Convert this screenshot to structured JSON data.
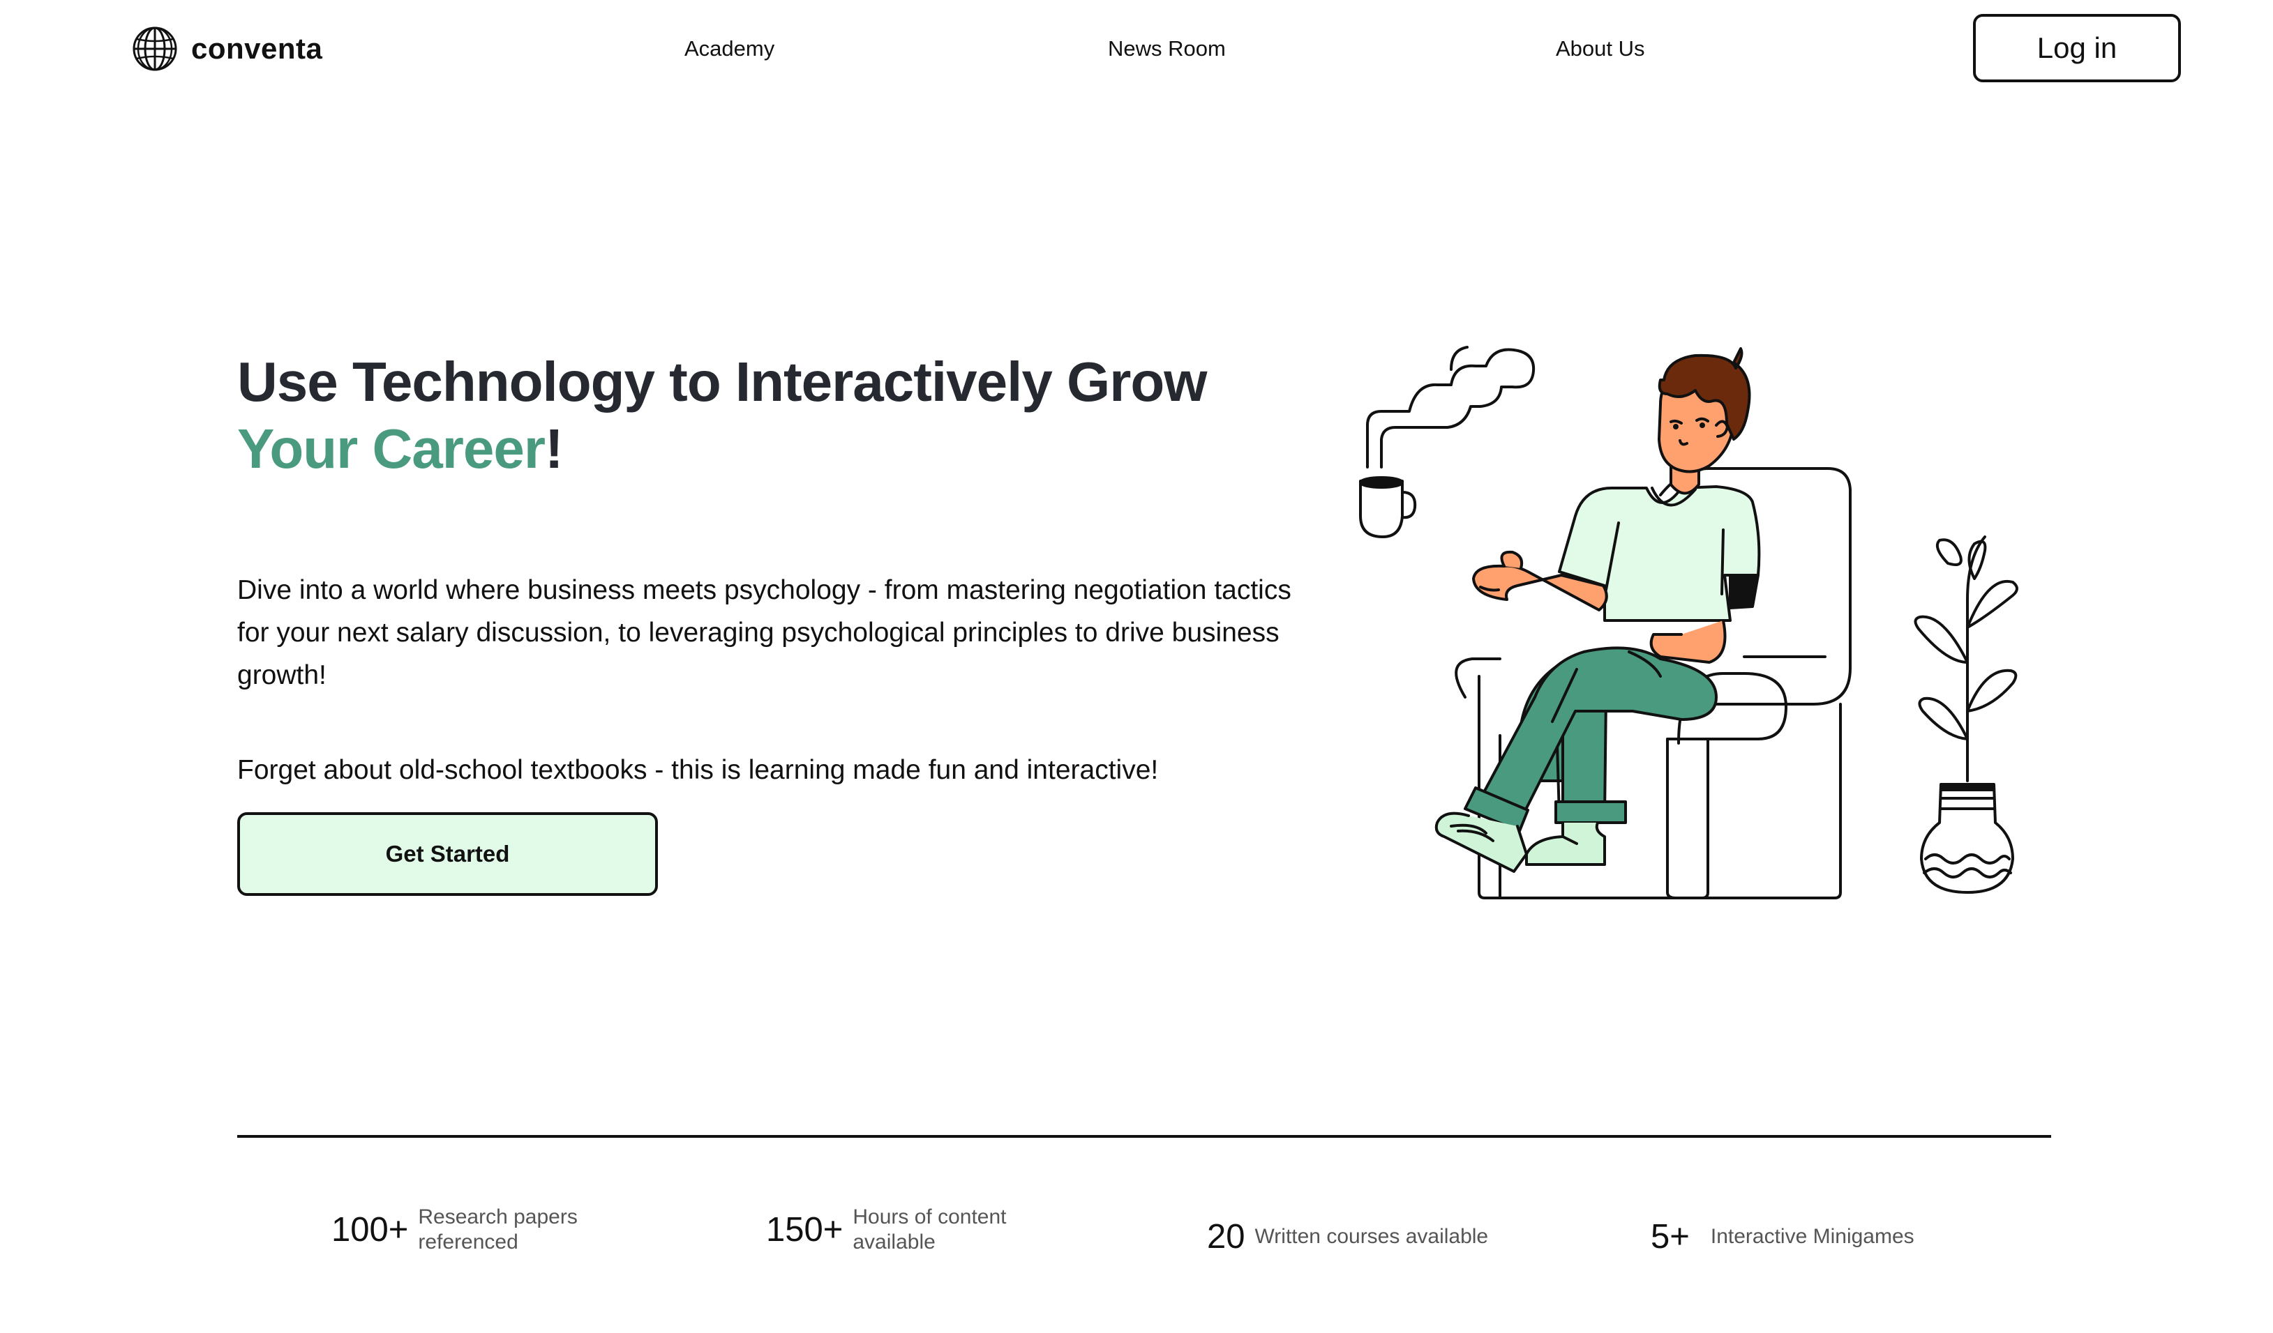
{
  "header": {
    "logo_text": "conventa",
    "nav": [
      {
        "label": "Academy"
      },
      {
        "label": "News Room"
      },
      {
        "label": "About Us"
      }
    ],
    "login_label": "Log in"
  },
  "hero": {
    "title_line1": "Use Technology to Interactively Grow",
    "title_accent": "Your Career",
    "title_end": "!",
    "description": "Dive into a world where business meets psychology - from mastering negotiation tactics for your next salary discussion, to leveraging psychological principles to drive business growth!",
    "tagline": "Forget about old-school textbooks - this is learning made fun and interactive!",
    "cta_label": "Get Started"
  },
  "stats": [
    {
      "value": "100+",
      "label_line1": "Research papers",
      "label_line2": "referenced"
    },
    {
      "value": "150+",
      "label_line1": "Hours of content",
      "label_line2": "available"
    },
    {
      "value": "20",
      "label_line1": "Written courses available",
      "label_line2": ""
    },
    {
      "value": "5+",
      "label_line1": "Interactive Minigames",
      "label_line2": ""
    }
  ],
  "colors": {
    "accent_green": "#4a9a7f",
    "mint": "#e2fbe8",
    "skin": "#ffa06f",
    "hair": "#6b2a0c",
    "text_dark": "#262a30"
  },
  "icons": {
    "logo": "globe-icon",
    "illustration": "man-in-armchair-with-coffee"
  }
}
